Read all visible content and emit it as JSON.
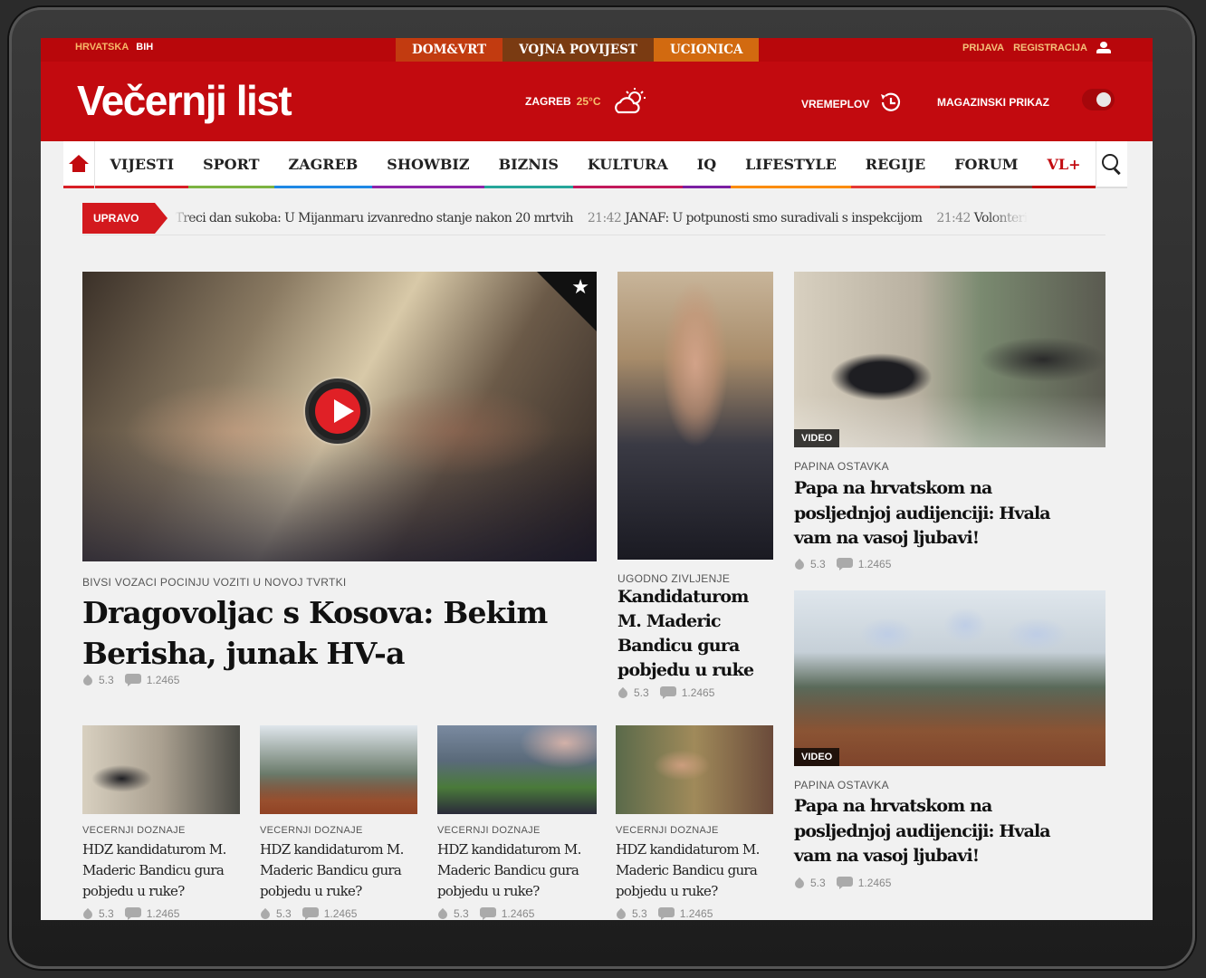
{
  "topbar": {
    "region_hr": "HRVATSKA",
    "region_bih": "BIH",
    "special": [
      "DOM&VRT",
      "VOJNA POVIJEST",
      "UCIONICA"
    ],
    "login": "PRIJAVA",
    "register": "REGISTRACIJA"
  },
  "header": {
    "logo": "Večernji list",
    "city": "ZAGREB",
    "temp": "25°C",
    "timeline": "VREMEPLOV",
    "magazine": "MAGAZINSKI PRIKAZ"
  },
  "nav": {
    "items": [
      "VIJESTI",
      "SPORT",
      "ZAGREB",
      "SHOWBIZ",
      "BIZNIS",
      "KULTURA",
      "IQ",
      "LIFESTYLE",
      "REGIJE",
      "FORUM",
      "VL+"
    ],
    "colors": [
      "#d81f26",
      "#7cb342",
      "#1e88e5",
      "#8e24aa",
      "#26a69a",
      "#c2185b",
      "#7b1fa2",
      "#fb8c00",
      "#e53935",
      "#6d4c41",
      "#c20a0f"
    ]
  },
  "ticker": {
    "label": "UPRAVO",
    "items": [
      {
        "time": "",
        "text": "Treci dan sukoba: U Mijanmaru izvanredno stanje nakon 20 mrtvih"
      },
      {
        "time": "21:42",
        "text": "JANAF: U potpunosti smo suradivali s inspekcijom"
      },
      {
        "time": "21:42",
        "text": "Volonteri"
      }
    ]
  },
  "main": {
    "kicker": "BIVSI VOZACI POCINJU VOZITI U NOVOJ TVRTKI",
    "title_line1": "Dragovoljac s Kosova: Bekim",
    "title_line2": "Berisha, junak HV-a",
    "rating": "5.3",
    "comments": "1.2465"
  },
  "mid": {
    "kicker": "UGODNO ZIVLJENJE",
    "lines": [
      "Kandidaturom",
      "M. Maderic",
      "Bandicu gura",
      "pobjedu u ruke"
    ],
    "rating": "5.3",
    "comments": "1.2465"
  },
  "right1": {
    "badge": "VIDEO",
    "kicker": "PAPINA OSTAVKA",
    "lines": [
      "Papa na hrvatskom na",
      "posljednjoj audijenciji: Hvala",
      "vam na vasoj ljubavi!"
    ],
    "rating": "5.3",
    "comments": "1.2465"
  },
  "right2": {
    "badge": "VIDEO",
    "kicker": "PAPINA OSTAVKA",
    "lines": [
      "Papa na hrvatskom na",
      "posljednjoj audijenciji: Hvala",
      "vam na vasoj ljubavi!"
    ],
    "rating": "5.3",
    "comments": "1.2465"
  },
  "small": [
    {
      "kicker": "VECERNJI DOZNAJE",
      "lines": [
        "HDZ kandidaturom M.",
        "Maderic Bandicu gura",
        "pobjedu u ruke?"
      ],
      "rating": "5.3",
      "comments": "1.2465"
    },
    {
      "kicker": "VECERNJI DOZNAJE",
      "lines": [
        "HDZ kandidaturom M.",
        "Maderic Bandicu gura",
        "pobjedu u ruke?"
      ],
      "rating": "5.3",
      "comments": "1.2465"
    },
    {
      "kicker": "VECERNJI DOZNAJE",
      "lines": [
        "HDZ kandidaturom M.",
        "Maderic Bandicu gura",
        "pobjedu u ruke?"
      ],
      "rating": "5.3",
      "comments": "1.2465"
    },
    {
      "kicker": "VECERNJI DOZNAJE",
      "lines": [
        "HDZ kandidaturom M.",
        "Maderic Bandicu gura",
        "pobjedu u ruke?"
      ],
      "rating": "5.3",
      "comments": "1.2465"
    }
  ]
}
